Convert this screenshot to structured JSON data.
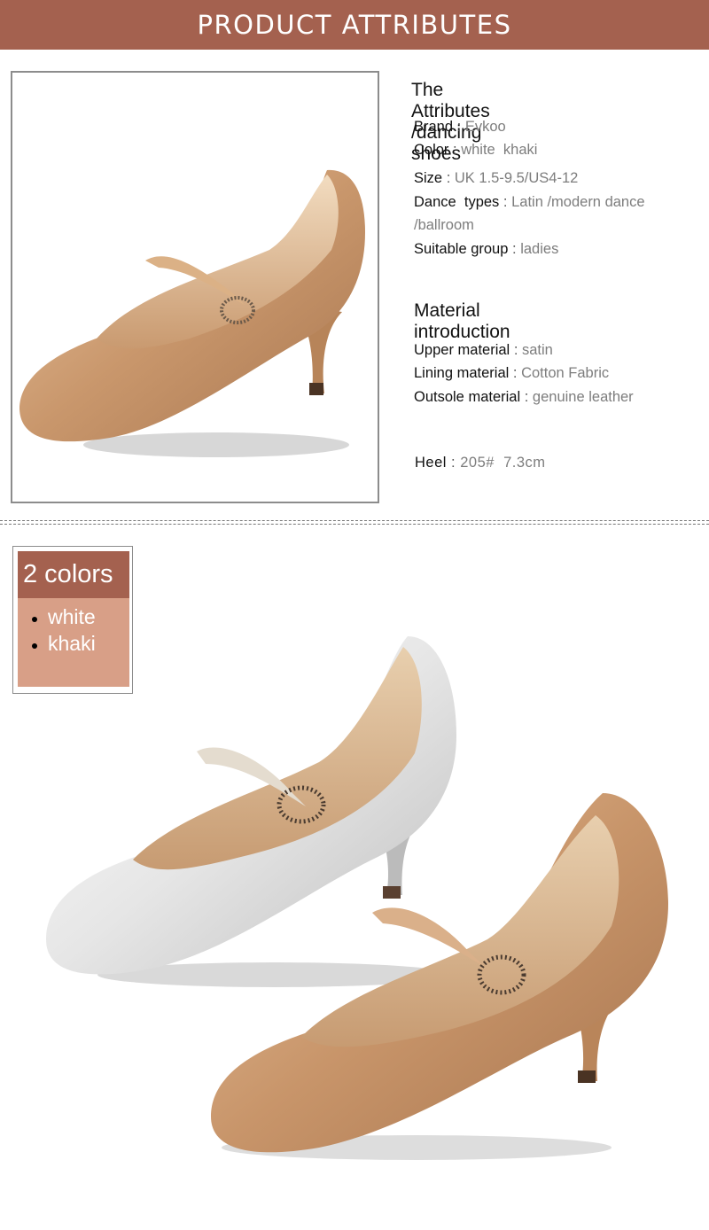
{
  "banner": {
    "title": "PRODUCT ATTRIBUTES"
  },
  "attributes": {
    "heading": "The Attributes /dancing shoes",
    "brand": {
      "key": "Brand",
      "sep": ":",
      "value": "Evkoo"
    },
    "color": {
      "key": "Color",
      "sep": ":",
      "value": "white  khaki"
    },
    "size": {
      "key": "Size",
      "sep": ":",
      "value": "UK 1.5-9.5/US4-12"
    },
    "dance_types": {
      "key": "Dance  types",
      "sep": ":",
      "value": "Latin /modern dance",
      "value_line2": "/ballroom"
    },
    "suitable_group": {
      "key": "Suitable group",
      "sep": ":",
      "value": "ladies"
    }
  },
  "material": {
    "heading": "Material introduction",
    "upper": {
      "key": "Upper material",
      "sep": ":",
      "value": "satin"
    },
    "lining": {
      "key": "Lining material",
      "sep": ":",
      "value": "Cotton Fabric"
    },
    "outsole": {
      "key": "Outsole material",
      "sep": ":",
      "value": "genuine leather"
    }
  },
  "heel": {
    "key": "Heel",
    "sep": ":",
    "value": "205#  7.3cm"
  },
  "colors_box": {
    "title": "2 colors",
    "items": [
      "white",
      "khaki"
    ]
  },
  "palette": {
    "brand_brown": "#a4614f",
    "swatch_peach": "#d89f87",
    "khaki_satin": "#c99b72",
    "white_satin": "#eeeeee"
  },
  "images": {
    "main_photo": "khaki-shoe-photo",
    "pair_photo": "white-and-khaki-shoes-photo"
  }
}
